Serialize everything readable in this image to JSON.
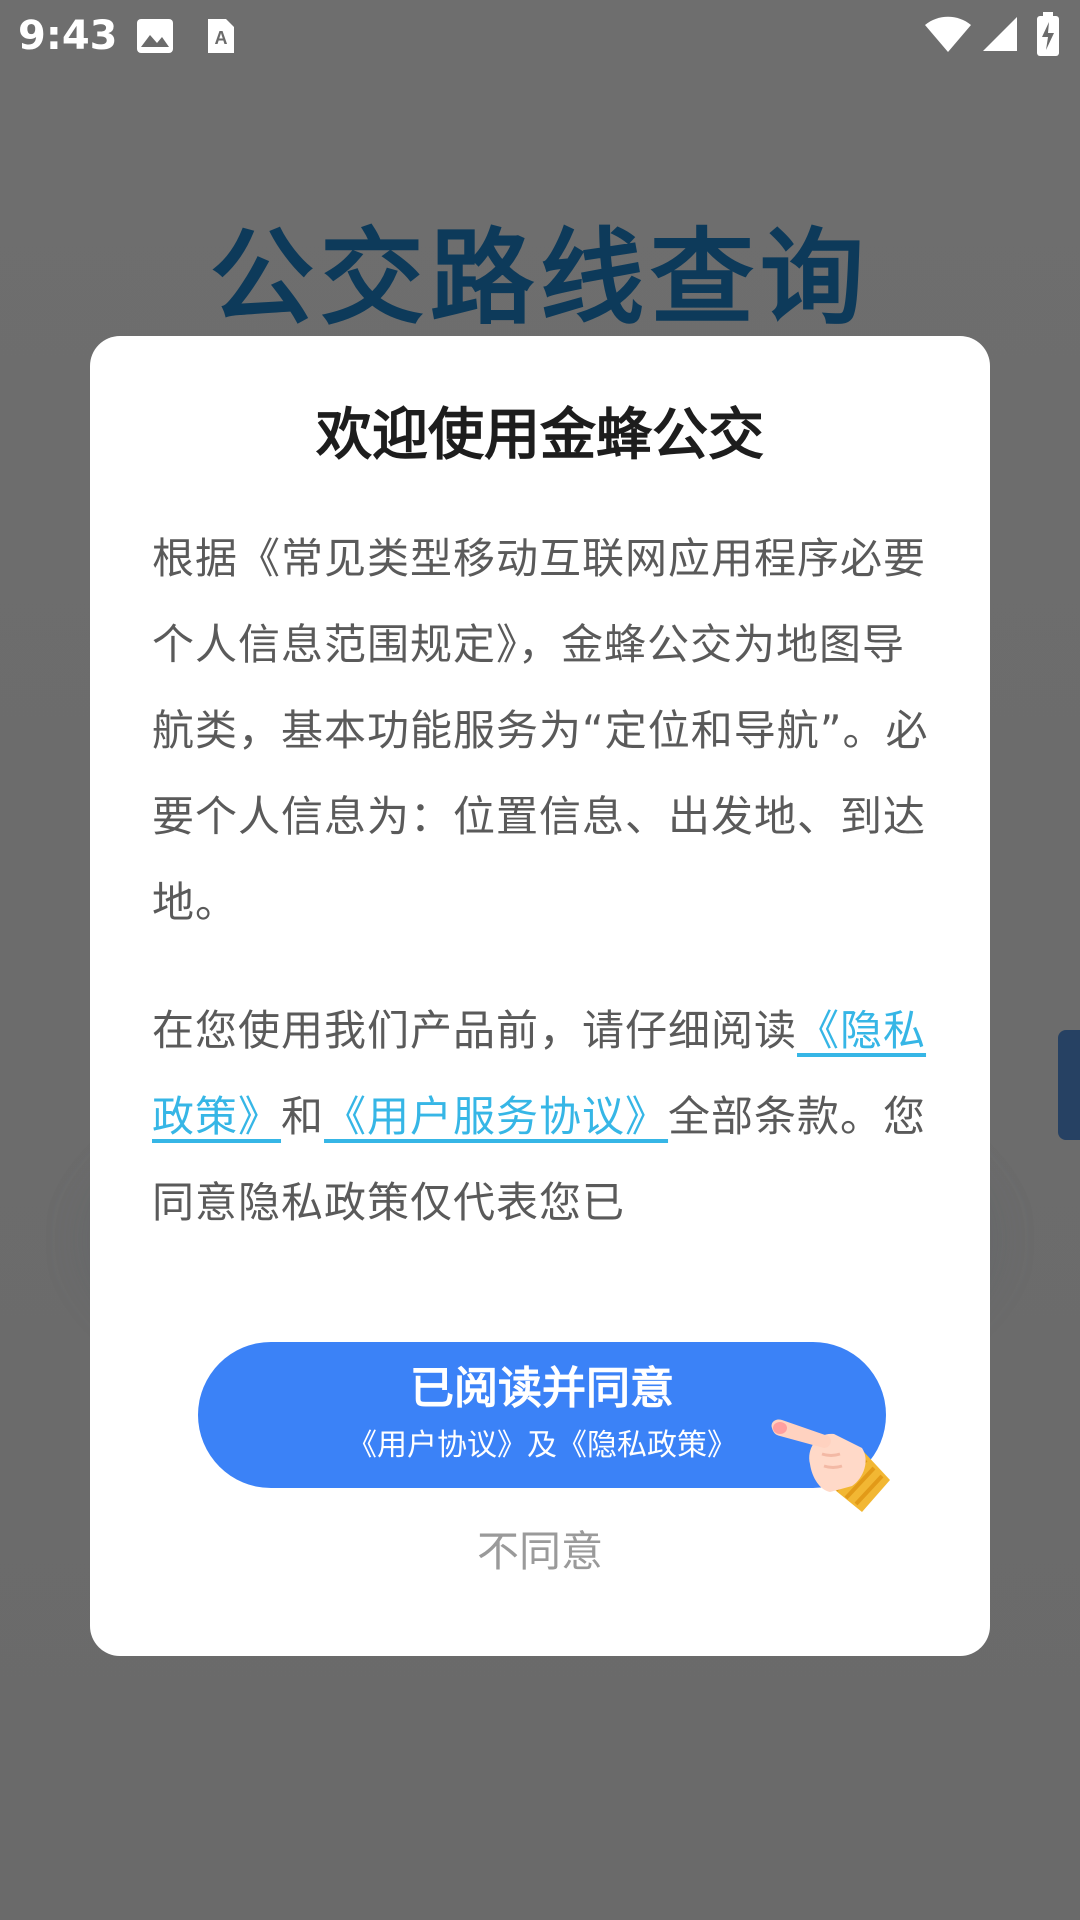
{
  "status_bar": {
    "time": "9:43",
    "icons": [
      "image-icon",
      "a-icon",
      "wifi-icon",
      "signal-icon",
      "battery-charging-icon"
    ]
  },
  "background": {
    "title": "公交路线查询"
  },
  "dialog": {
    "title": "欢迎使用金蜂公交",
    "para1": "根据《常见类型移动互联网应用程序必要个人信息范围规定》，金蜂公交为地图导航类，基本功能服务为“定位和导航”。必要个人信息为：位置信息、出发地、到达地。",
    "para2_prefix": "在您使用我们产品前，请仔细阅读",
    "privacy_link": "《隐私政策》",
    "para2_and": "和",
    "service_link": "《用户服务协议》",
    "para2_suffix": "全部条款。您同意隐私政策仅代表您已",
    "agree_button": {
      "main": "已阅读并同意",
      "sub": "《用户协议》及《隐私政策》"
    },
    "disagree_button": "不同意"
  },
  "colors": {
    "overlay": "#6b6b6b",
    "primary_button": "#3b82f7",
    "link": "#36b6e6",
    "body_text": "#5a5a5a",
    "title_text": "#1d1d1d",
    "disagree_text": "#9a9a9a"
  }
}
